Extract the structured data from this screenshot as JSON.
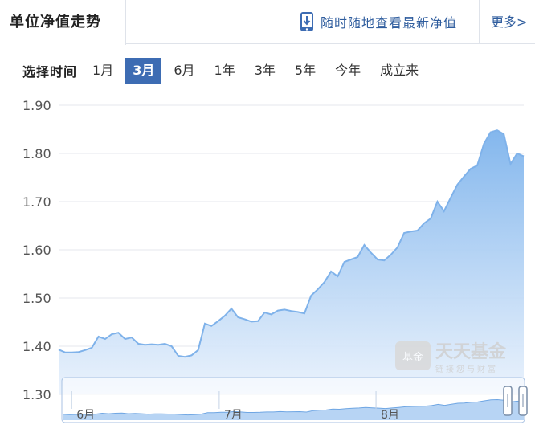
{
  "header": {
    "title": "单位净值走势",
    "mobile_link": "随时随地查看最新净值",
    "more": "更多>"
  },
  "range": {
    "label": "选择时间",
    "options": [
      "1月",
      "3月",
      "6月",
      "1年",
      "3年",
      "5年",
      "今年",
      "成立来"
    ],
    "active": "3月"
  },
  "watermark": {
    "name": "天天基金",
    "slogan": "链接您与财富",
    "badge": "基金"
  },
  "colors": {
    "accent": "#3d6cb3",
    "line": "#7fb2ea",
    "fill_top": "#7db3ec",
    "fill_bottom": "#e8f1fc"
  },
  "chart_data": {
    "type": "area",
    "ylim": [
      1.3,
      1.9
    ],
    "yticks": [
      "1.90",
      "1.80",
      "1.70",
      "1.60",
      "1.50",
      "1.40",
      "1.30"
    ],
    "x_months": [
      "6月",
      "7月",
      "8月"
    ],
    "values": [
      1.393,
      1.387,
      1.387,
      1.388,
      1.392,
      1.397,
      1.42,
      1.415,
      1.425,
      1.428,
      1.415,
      1.418,
      1.405,
      1.403,
      1.404,
      1.403,
      1.405,
      1.4,
      1.38,
      1.378,
      1.381,
      1.392,
      1.447,
      1.442,
      1.452,
      1.463,
      1.478,
      1.46,
      1.456,
      1.451,
      1.452,
      1.47,
      1.466,
      1.474,
      1.476,
      1.473,
      1.471,
      1.468,
      1.505,
      1.518,
      1.533,
      1.555,
      1.545,
      1.575,
      1.58,
      1.585,
      1.61,
      1.594,
      1.58,
      1.578,
      1.59,
      1.605,
      1.635,
      1.638,
      1.64,
      1.655,
      1.665,
      1.7,
      1.68,
      1.708,
      1.735,
      1.752,
      1.768,
      1.775,
      1.82,
      1.844,
      1.848,
      1.84,
      1.778,
      1.8,
      1.794
    ]
  }
}
